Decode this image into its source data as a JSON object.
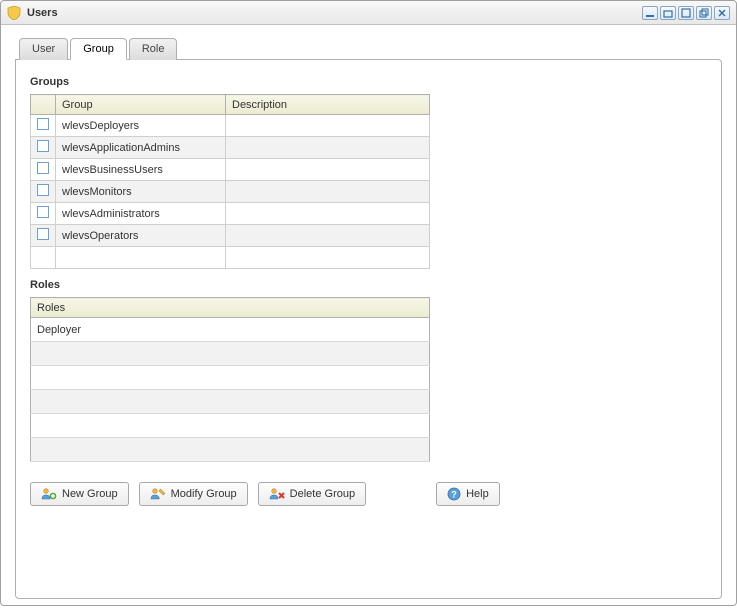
{
  "window": {
    "title": "Users"
  },
  "tabs": [
    {
      "label": "User",
      "active": false
    },
    {
      "label": "Group",
      "active": true
    },
    {
      "label": "Role",
      "active": false
    }
  ],
  "groups": {
    "section_label": "Groups",
    "columns": {
      "checkbox": "",
      "group": "Group",
      "description": "Description"
    },
    "rows": [
      {
        "name": "wlevsDeployers",
        "description": ""
      },
      {
        "name": "wlevsApplicationAdmins",
        "description": ""
      },
      {
        "name": "wlevsBusinessUsers",
        "description": ""
      },
      {
        "name": "wlevsMonitors",
        "description": ""
      },
      {
        "name": "wlevsAdministrators",
        "description": ""
      },
      {
        "name": "wlevsOperators",
        "description": ""
      }
    ],
    "footer_num": ""
  },
  "roles": {
    "section_label": "Roles",
    "column": "Roles",
    "rows": [
      "Deployer",
      "",
      "",
      "",
      "",
      ""
    ]
  },
  "buttons": {
    "new_group": "New Group",
    "modify_group": "Modify Group",
    "delete_group": "Delete Group",
    "help": "Help"
  }
}
